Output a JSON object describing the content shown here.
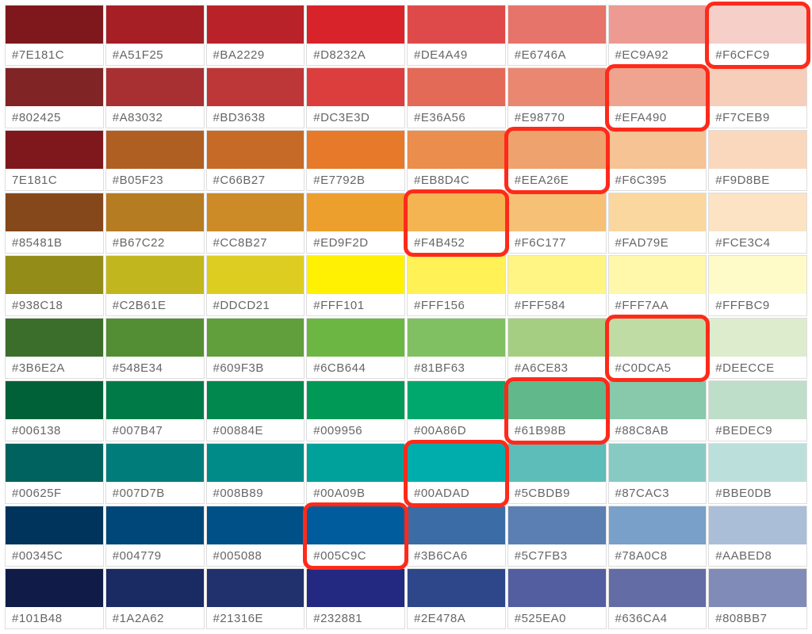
{
  "rows": [
    {
      "cells": [
        {
          "hex": "#7E181C",
          "color": "#7E181C",
          "highlighted": false
        },
        {
          "hex": "#A51F25",
          "color": "#A51F25",
          "highlighted": false
        },
        {
          "hex": "#BA2229",
          "color": "#BA2229",
          "highlighted": false
        },
        {
          "hex": "#D8232A",
          "color": "#D8232A",
          "highlighted": false
        },
        {
          "hex": "#DE4A49",
          "color": "#DE4A49",
          "highlighted": false
        },
        {
          "hex": "#E6746A",
          "color": "#E6746A",
          "highlighted": false
        },
        {
          "hex": "#EC9A92",
          "color": "#EC9A92",
          "highlighted": false
        },
        {
          "hex": "#F6CFC9",
          "color": "#F6CFC9",
          "highlighted": true
        }
      ]
    },
    {
      "cells": [
        {
          "hex": "#802425",
          "color": "#802425",
          "highlighted": false
        },
        {
          "hex": "#A83032",
          "color": "#A83032",
          "highlighted": false
        },
        {
          "hex": "#BD3638",
          "color": "#BD3638",
          "highlighted": false
        },
        {
          "hex": "#DC3E3D",
          "color": "#DC3E3D",
          "highlighted": false
        },
        {
          "hex": "#E36A56",
          "color": "#E36A56",
          "highlighted": false
        },
        {
          "hex": "#E98770",
          "color": "#E98770",
          "highlighted": false
        },
        {
          "hex": "#EFA490",
          "color": "#EFA490",
          "highlighted": true
        },
        {
          "hex": "#F7CEB9",
          "color": "#F7CEB9",
          "highlighted": false
        }
      ]
    },
    {
      "cells": [
        {
          "hex": "7E181C",
          "color": "#7E181C",
          "highlighted": false
        },
        {
          "hex": "#B05F23",
          "color": "#B05F23",
          "highlighted": false
        },
        {
          "hex": "#C66B27",
          "color": "#C66B27",
          "highlighted": false
        },
        {
          "hex": "#E7792B",
          "color": "#E7792B",
          "highlighted": false
        },
        {
          "hex": "#EB8D4C",
          "color": "#EB8D4C",
          "highlighted": false
        },
        {
          "hex": "#EEA26E",
          "color": "#EEA26E",
          "highlighted": true
        },
        {
          "hex": "#F6C395",
          "color": "#F6C395",
          "highlighted": false
        },
        {
          "hex": "#F9D8BE",
          "color": "#F9D8BE",
          "highlighted": false
        }
      ]
    },
    {
      "cells": [
        {
          "hex": "#85481B",
          "color": "#85481B",
          "highlighted": false
        },
        {
          "hex": "#B67C22",
          "color": "#B67C22",
          "highlighted": false
        },
        {
          "hex": "#CC8B27",
          "color": "#CC8B27",
          "highlighted": false
        },
        {
          "hex": "#ED9F2D",
          "color": "#ED9F2D",
          "highlighted": false
        },
        {
          "hex": "#F4B452",
          "color": "#F4B452",
          "highlighted": true
        },
        {
          "hex": "#F6C177",
          "color": "#F6C177",
          "highlighted": false
        },
        {
          "hex": "#FAD79E",
          "color": "#FAD79E",
          "highlighted": false
        },
        {
          "hex": "#FCE3C4",
          "color": "#FCE3C4",
          "highlighted": false
        }
      ]
    },
    {
      "cells": [
        {
          "hex": "#938C18",
          "color": "#938C18",
          "highlighted": false
        },
        {
          "hex": "#C2B61E",
          "color": "#C2B61E",
          "highlighted": false
        },
        {
          "hex": "#DDCD21",
          "color": "#DDCD21",
          "highlighted": false
        },
        {
          "hex": "#FFF101",
          "color": "#FFF101",
          "highlighted": false
        },
        {
          "hex": "#FFF156",
          "color": "#FFF156",
          "highlighted": false
        },
        {
          "hex": "#FFF584",
          "color": "#FFF584",
          "highlighted": false
        },
        {
          "hex": "#FFF7AA",
          "color": "#FFF7AA",
          "highlighted": false
        },
        {
          "hex": "#FFFBC9",
          "color": "#FFFBC9",
          "highlighted": false
        }
      ]
    },
    {
      "cells": [
        {
          "hex": "#3B6E2A",
          "color": "#3B6E2A",
          "highlighted": false
        },
        {
          "hex": "#548E34",
          "color": "#548E34",
          "highlighted": false
        },
        {
          "hex": "#609F3B",
          "color": "#609F3B",
          "highlighted": false
        },
        {
          "hex": "#6CB644",
          "color": "#6CB644",
          "highlighted": false
        },
        {
          "hex": "#81BF63",
          "color": "#81BF63",
          "highlighted": false
        },
        {
          "hex": "#A6CE83",
          "color": "#A6CE83",
          "highlighted": false
        },
        {
          "hex": "#C0DCA5",
          "color": "#C0DCA5",
          "highlighted": true
        },
        {
          "hex": "#DEECCE",
          "color": "#DEECCE",
          "highlighted": false
        }
      ]
    },
    {
      "cells": [
        {
          "hex": "#006138",
          "color": "#006138",
          "highlighted": false
        },
        {
          "hex": "#007B47",
          "color": "#007B47",
          "highlighted": false
        },
        {
          "hex": "#00884E",
          "color": "#00884E",
          "highlighted": false
        },
        {
          "hex": "#009956",
          "color": "#009956",
          "highlighted": false
        },
        {
          "hex": "#00A86D",
          "color": "#00A86D",
          "highlighted": false
        },
        {
          "hex": "#61B98B",
          "color": "#61B98B",
          "highlighted": true
        },
        {
          "hex": "#88C8AB",
          "color": "#88C8AB",
          "highlighted": false
        },
        {
          "hex": "#BEDEC9",
          "color": "#BEDEC9",
          "highlighted": false
        }
      ]
    },
    {
      "cells": [
        {
          "hex": "#00625F",
          "color": "#00625F",
          "highlighted": false
        },
        {
          "hex": "#007D7B",
          "color": "#007D7B",
          "highlighted": false
        },
        {
          "hex": "#008B89",
          "color": "#008B89",
          "highlighted": false
        },
        {
          "hex": "#00A09B",
          "color": "#00A09B",
          "highlighted": false
        },
        {
          "hex": "#00ADAD",
          "color": "#00ADAD",
          "highlighted": true
        },
        {
          "hex": "#5CBDB9",
          "color": "#5CBDB9",
          "highlighted": false
        },
        {
          "hex": "#87CAC3",
          "color": "#87CAC3",
          "highlighted": false
        },
        {
          "hex": "#BBE0DB",
          "color": "#BBE0DB",
          "highlighted": false
        }
      ]
    },
    {
      "cells": [
        {
          "hex": "#00345C",
          "color": "#00345C",
          "highlighted": false
        },
        {
          "hex": "#004779",
          "color": "#004779",
          "highlighted": false
        },
        {
          "hex": "#005088",
          "color": "#005088",
          "highlighted": false
        },
        {
          "hex": "#005C9C",
          "color": "#005C9C",
          "highlighted": true
        },
        {
          "hex": "#3B6CA6",
          "color": "#3B6CA6",
          "highlighted": false
        },
        {
          "hex": "#5C7FB3",
          "color": "#5C7FB3",
          "highlighted": false
        },
        {
          "hex": "#78A0C8",
          "color": "#78A0C8",
          "highlighted": false
        },
        {
          "hex": "#AABED8",
          "color": "#AABED8",
          "highlighted": false
        }
      ]
    },
    {
      "cells": [
        {
          "hex": "#101B48",
          "color": "#101B48",
          "highlighted": false
        },
        {
          "hex": "#1A2A62",
          "color": "#1A2A62",
          "highlighted": false
        },
        {
          "hex": "#21316E",
          "color": "#21316E",
          "highlighted": false
        },
        {
          "hex": "#232881",
          "color": "#232881",
          "highlighted": false
        },
        {
          "hex": "#2E478A",
          "color": "#2E478A",
          "highlighted": false
        },
        {
          "hex": "#525EA0",
          "color": "#525EA0",
          "highlighted": false
        },
        {
          "hex": "#636CA4",
          "color": "#636CA4",
          "highlighted": false
        },
        {
          "hex": "#808BB7",
          "color": "#808BB7",
          "highlighted": false
        }
      ]
    }
  ]
}
